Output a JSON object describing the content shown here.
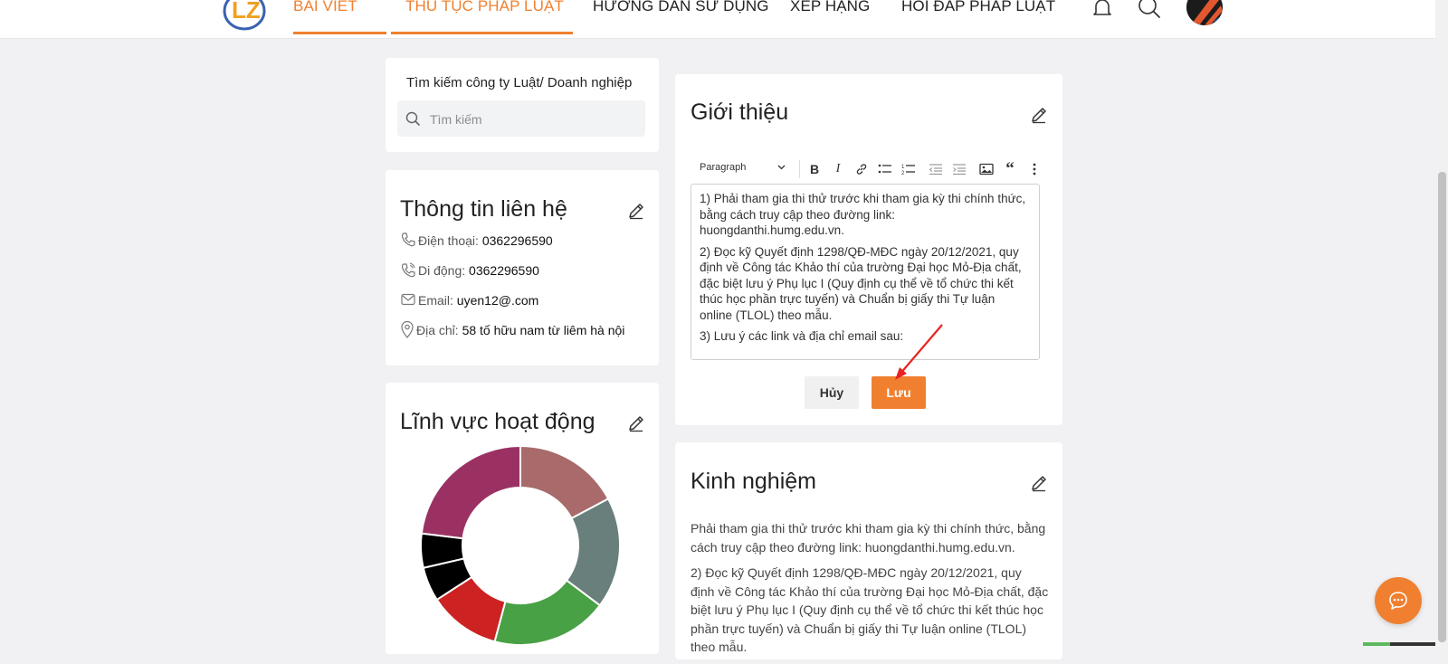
{
  "header": {
    "nav": [
      {
        "label": "BÀI VIẾT",
        "active": true
      },
      {
        "label": "THỦ TỤC PHÁP LUẬT",
        "active": true
      },
      {
        "label": "HƯỚNG DẪN SỬ DỤNG",
        "active": false
      },
      {
        "label": "XẾP HẠNG",
        "active": false
      },
      {
        "label": "HỎI ĐÁP PHÁP LUẬT",
        "active": false
      }
    ],
    "icons": [
      "bell-icon",
      "search-icon",
      "avatar"
    ]
  },
  "search_card": {
    "label": "Tìm kiếm công ty Luật/ Doanh nghiệp",
    "placeholder": "Tìm kiếm"
  },
  "contact_card": {
    "title": "Thông tin liên hệ",
    "rows": [
      {
        "label": "Điện thoại: ",
        "value": "0362296590",
        "icon": "phone-icon"
      },
      {
        "label": "Di động: ",
        "value": "0362296590",
        "icon": "mobile-phone-icon"
      },
      {
        "label": "Email: ",
        "value": "uyen12@.com",
        "icon": "mail-icon"
      },
      {
        "label": "Địa chỉ: ",
        "value": "58 tố hữu nam từ liêm hà nội",
        "icon": "location-pin-icon"
      }
    ]
  },
  "field_card": {
    "title": "Lĩnh vực hoạt động",
    "chart_data": {
      "type": "pie",
      "segment_colors": [
        "#a86a6a",
        "#687f7b",
        "#48a145",
        "#cc2222",
        "#000000",
        "#000000",
        "#9b3162"
      ]
    }
  },
  "intro_card": {
    "title": "Giới thiệu",
    "toolbar": {
      "paragraph_label": "Paragraph",
      "buttons": [
        "bold-icon",
        "italic-icon",
        "link-icon",
        "bulleted-list-icon",
        "numbered-list-icon",
        "outdent-icon",
        "indent-icon",
        "image-icon",
        "blockquote-icon",
        "more-icon"
      ]
    },
    "paragraphs": [
      "1) Phải tham gia thi thử trước khi tham gia kỳ thi chính thức, bằng cách truy cập theo đường link: huongdanthi.humg.edu.vn.",
      "2) Đọc kỹ Quyết định 1298/QĐ-MĐC ngày 20/12/2021, quy định về Công tác Khảo thí của trường Đại học Mỏ-Địa chất, đặc biệt lưu ý Phụ lục I (Quy định cụ thể về tổ chức thi kết thúc học phần trực tuyến) và Chuẩn bị giấy thi Tự luận online (TLOL) theo mẫu.",
      "3) Lưu ý các link và địa chỉ email sau:"
    ],
    "cancel_label": "Hủy",
    "save_label": "Lưu"
  },
  "experience_card": {
    "title": "Kinh nghiệm",
    "paragraphs": [
      "Phải tham gia thi thử trước khi tham gia kỳ thi chính thức, bằng cách truy cập theo đường link: huongdanthi.humg.edu.vn.",
      "2) Đọc kỹ Quyết định 1298/QĐ-MĐC ngày 20/12/2021, quy định về Công tác Khảo thí của trường Đại học Mỏ-Địa chất, đặc biệt lưu ý Phụ lục I (Quy định cụ thể về tổ chức thi kết thúc học phần trực tuyến) và Chuẩn bị giấy thi Tự luận online (TLOL) theo mẫu."
    ]
  },
  "colors": {
    "accent": "#f0802f",
    "page_background": "#f1f1f3",
    "annotation_arrow": "#e8231f"
  }
}
